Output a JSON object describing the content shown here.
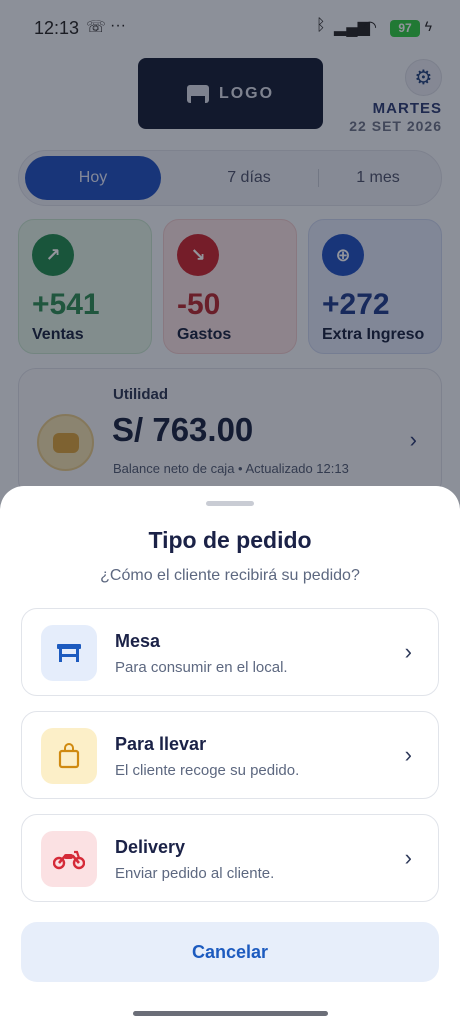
{
  "status_bar": {
    "time": "12:13",
    "more": "···",
    "battery": "97"
  },
  "header": {
    "logo_text": "LOGO",
    "day": "MARTES",
    "date": "22 SET 2026"
  },
  "range_tabs": [
    "Hoy",
    "7 días",
    "1 mes"
  ],
  "stats": [
    {
      "value": "+541",
      "label": "Ventas"
    },
    {
      "value": "-50",
      "label": "Gastos"
    },
    {
      "value": "+272",
      "label": "Extra Ingreso"
    }
  ],
  "utility": {
    "title": "Utilidad",
    "amount": "S/ 763.00",
    "subtitle": "Balance neto de caja • Actualizado 12:13"
  },
  "sheet": {
    "title": "Tipo de pedido",
    "subtitle": "¿Cómo el cliente recibirá su pedido?",
    "options": [
      {
        "name": "Mesa",
        "description": "Para consumir en el local.",
        "icon": "table-icon"
      },
      {
        "name": "Para llevar",
        "description": "El cliente recoge su pedido.",
        "icon": "shopping-bag-icon"
      },
      {
        "name": "Delivery",
        "description": "Enviar pedido al cliente.",
        "icon": "motorcycle-icon"
      }
    ],
    "cancel_label": "Cancelar"
  },
  "colors": {
    "accent_blue": "#1d4fbf",
    "sales_green": "#1f8a4c",
    "expense_red": "#c7222c",
    "cancel_text": "#1d5bbf"
  }
}
